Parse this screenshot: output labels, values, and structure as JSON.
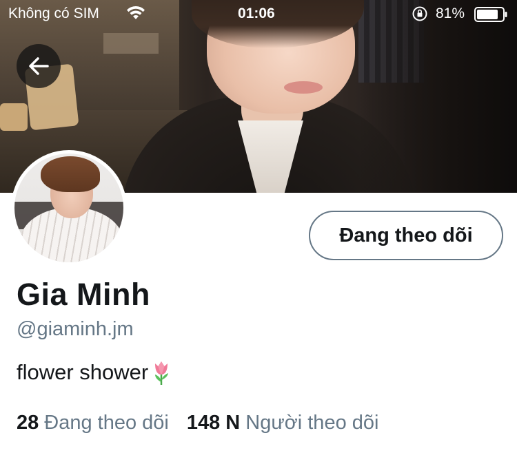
{
  "status_bar": {
    "carrier": "Không có SIM",
    "time": "01:06",
    "battery": "81%"
  },
  "profile": {
    "name": "Gia Minh",
    "handle": "@giaminh.jm",
    "bio": "flower shower",
    "bio_emoji": "tulip",
    "follow_button": "Đang theo dõi",
    "stats": {
      "following_count": "28",
      "following_label": "Đang theo dõi",
      "followers_count": "148 N",
      "followers_label": "Người theo dõi"
    }
  },
  "colors": {
    "text_primary": "#14171a",
    "text_secondary": "#657786",
    "button_border": "#657786",
    "background": "#ffffff"
  }
}
